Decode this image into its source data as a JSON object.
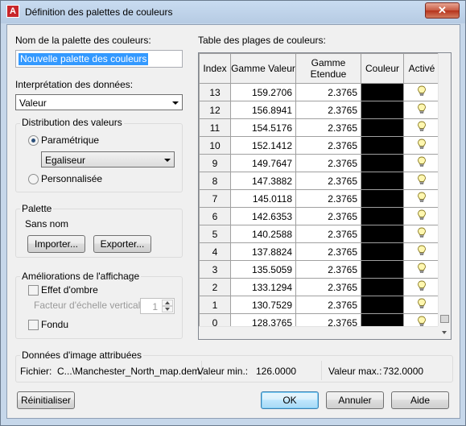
{
  "window": {
    "title": "Définition des palettes de couleurs",
    "close_label": "✕"
  },
  "palette_name": {
    "label": "Nom de la palette des couleurs:",
    "value": "Nouvelle palette des couleurs"
  },
  "interpretation": {
    "label": "Interprétation des données:",
    "value": "Valeur"
  },
  "distribution": {
    "title": "Distribution des valeurs",
    "parametric_label": "Paramétrique",
    "method_value": "Egaliseur",
    "custom_label": "Personnalisée",
    "selected": "parametric"
  },
  "palette": {
    "title": "Palette",
    "name": "Sans nom",
    "import_label": "Importer...",
    "export_label": "Exporter..."
  },
  "display": {
    "title": "Améliorations de l'affichage",
    "shadow_label": "Effet d'ombre",
    "scale_label": "Facteur d'échelle verticale",
    "scale_value": "1",
    "blend_label": "Fondu",
    "shadow_checked": false,
    "blend_checked": false
  },
  "table": {
    "title": "Table des plages de couleurs:",
    "headers": {
      "index": "Index",
      "value_range": "Gamme Valeur",
      "extent_range": "Gamme Etendue",
      "color": "Couleur",
      "active": "Activé"
    },
    "rows": [
      {
        "index": "13",
        "value": "159.2706",
        "extent": "2.3765",
        "color": "#000000"
      },
      {
        "index": "12",
        "value": "156.8941",
        "extent": "2.3765",
        "color": "#000000"
      },
      {
        "index": "11",
        "value": "154.5176",
        "extent": "2.3765",
        "color": "#000000"
      },
      {
        "index": "10",
        "value": "152.1412",
        "extent": "2.3765",
        "color": "#000000"
      },
      {
        "index": "9",
        "value": "149.7647",
        "extent": "2.3765",
        "color": "#000000"
      },
      {
        "index": "8",
        "value": "147.3882",
        "extent": "2.3765",
        "color": "#000000"
      },
      {
        "index": "7",
        "value": "145.0118",
        "extent": "2.3765",
        "color": "#000000"
      },
      {
        "index": "6",
        "value": "142.6353",
        "extent": "2.3765",
        "color": "#000000"
      },
      {
        "index": "5",
        "value": "140.2588",
        "extent": "2.3765",
        "color": "#000000"
      },
      {
        "index": "4",
        "value": "137.8824",
        "extent": "2.3765",
        "color": "#000000"
      },
      {
        "index": "3",
        "value": "135.5059",
        "extent": "2.3765",
        "color": "#000000"
      },
      {
        "index": "2",
        "value": "133.1294",
        "extent": "2.3765",
        "color": "#000000"
      },
      {
        "index": "1",
        "value": "130.7529",
        "extent": "2.3765",
        "color": "#000000"
      },
      {
        "index": "0",
        "value": "128.3765",
        "extent": "2.3765",
        "color": "#000000"
      }
    ],
    "active_icon": "lightbulb-icon"
  },
  "image_data": {
    "title": "Données d'image attribuées",
    "file_label": "Fichier:",
    "file_value": "C...\\Manchester_North_map.dem",
    "min_label": "Valeur min.:",
    "min_value": "126.0000",
    "max_label": "Valeur max.:",
    "max_value": "732.0000"
  },
  "buttons": {
    "reset": "Réinitialiser",
    "ok": "OK",
    "cancel": "Annuler",
    "help": "Aide"
  },
  "colors": {
    "title_bar": "#c9dcf1",
    "close_button": "#c75a43",
    "selection": "#3399ff",
    "default_button": "#bee6fd"
  }
}
